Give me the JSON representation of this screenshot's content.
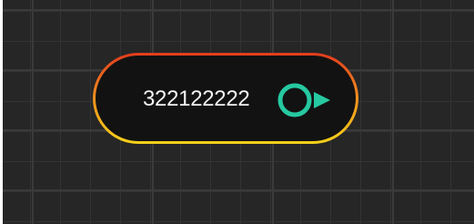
{
  "node": {
    "label": "322122222",
    "border_gradient": [
      "#e23b1d",
      "#f08a1e",
      "#f6d21a"
    ],
    "fill_color": "#121212",
    "output_port": {
      "icon": "output-port-icon",
      "color": "#26c9a1"
    }
  },
  "canvas": {
    "background_color": "#262626",
    "grid_color": "#333333"
  }
}
